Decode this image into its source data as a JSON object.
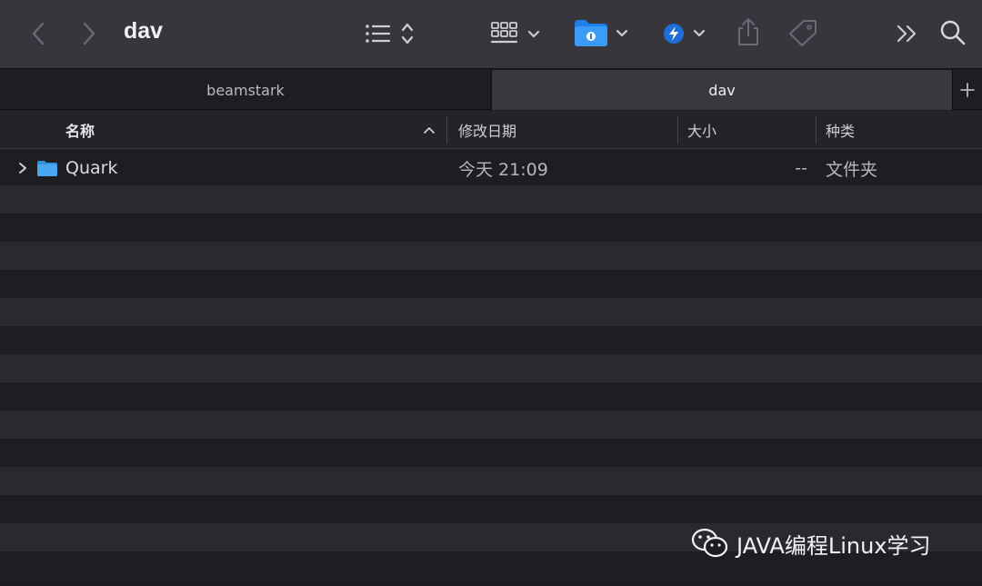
{
  "window": {
    "title": "dav"
  },
  "toolbar": {
    "back_icon": "chevron-left-icon",
    "forward_icon": "chevron-right-icon",
    "view_list_icon": "list-icon",
    "group_icon": "grid-icon",
    "app_folder_icon": "folder-app-icon",
    "app_spark_icon": "bolt-app-icon",
    "share_icon": "share-icon",
    "tag_icon": "tag-icon",
    "more_icon": "double-chevron-icon",
    "search_icon": "search-icon",
    "accent": "#2f8ff0"
  },
  "tabs": [
    {
      "label": "beamstark",
      "active": false
    },
    {
      "label": "dav",
      "active": true
    }
  ],
  "columns": {
    "name": "名称",
    "modified": "修改日期",
    "size": "大小",
    "kind": "种类"
  },
  "files": [
    {
      "name": "Quark",
      "modified": "今天 21:09",
      "size": "--",
      "kind": "文件夹"
    }
  ],
  "watermark": {
    "text": "JAVA编程Linux学习"
  }
}
